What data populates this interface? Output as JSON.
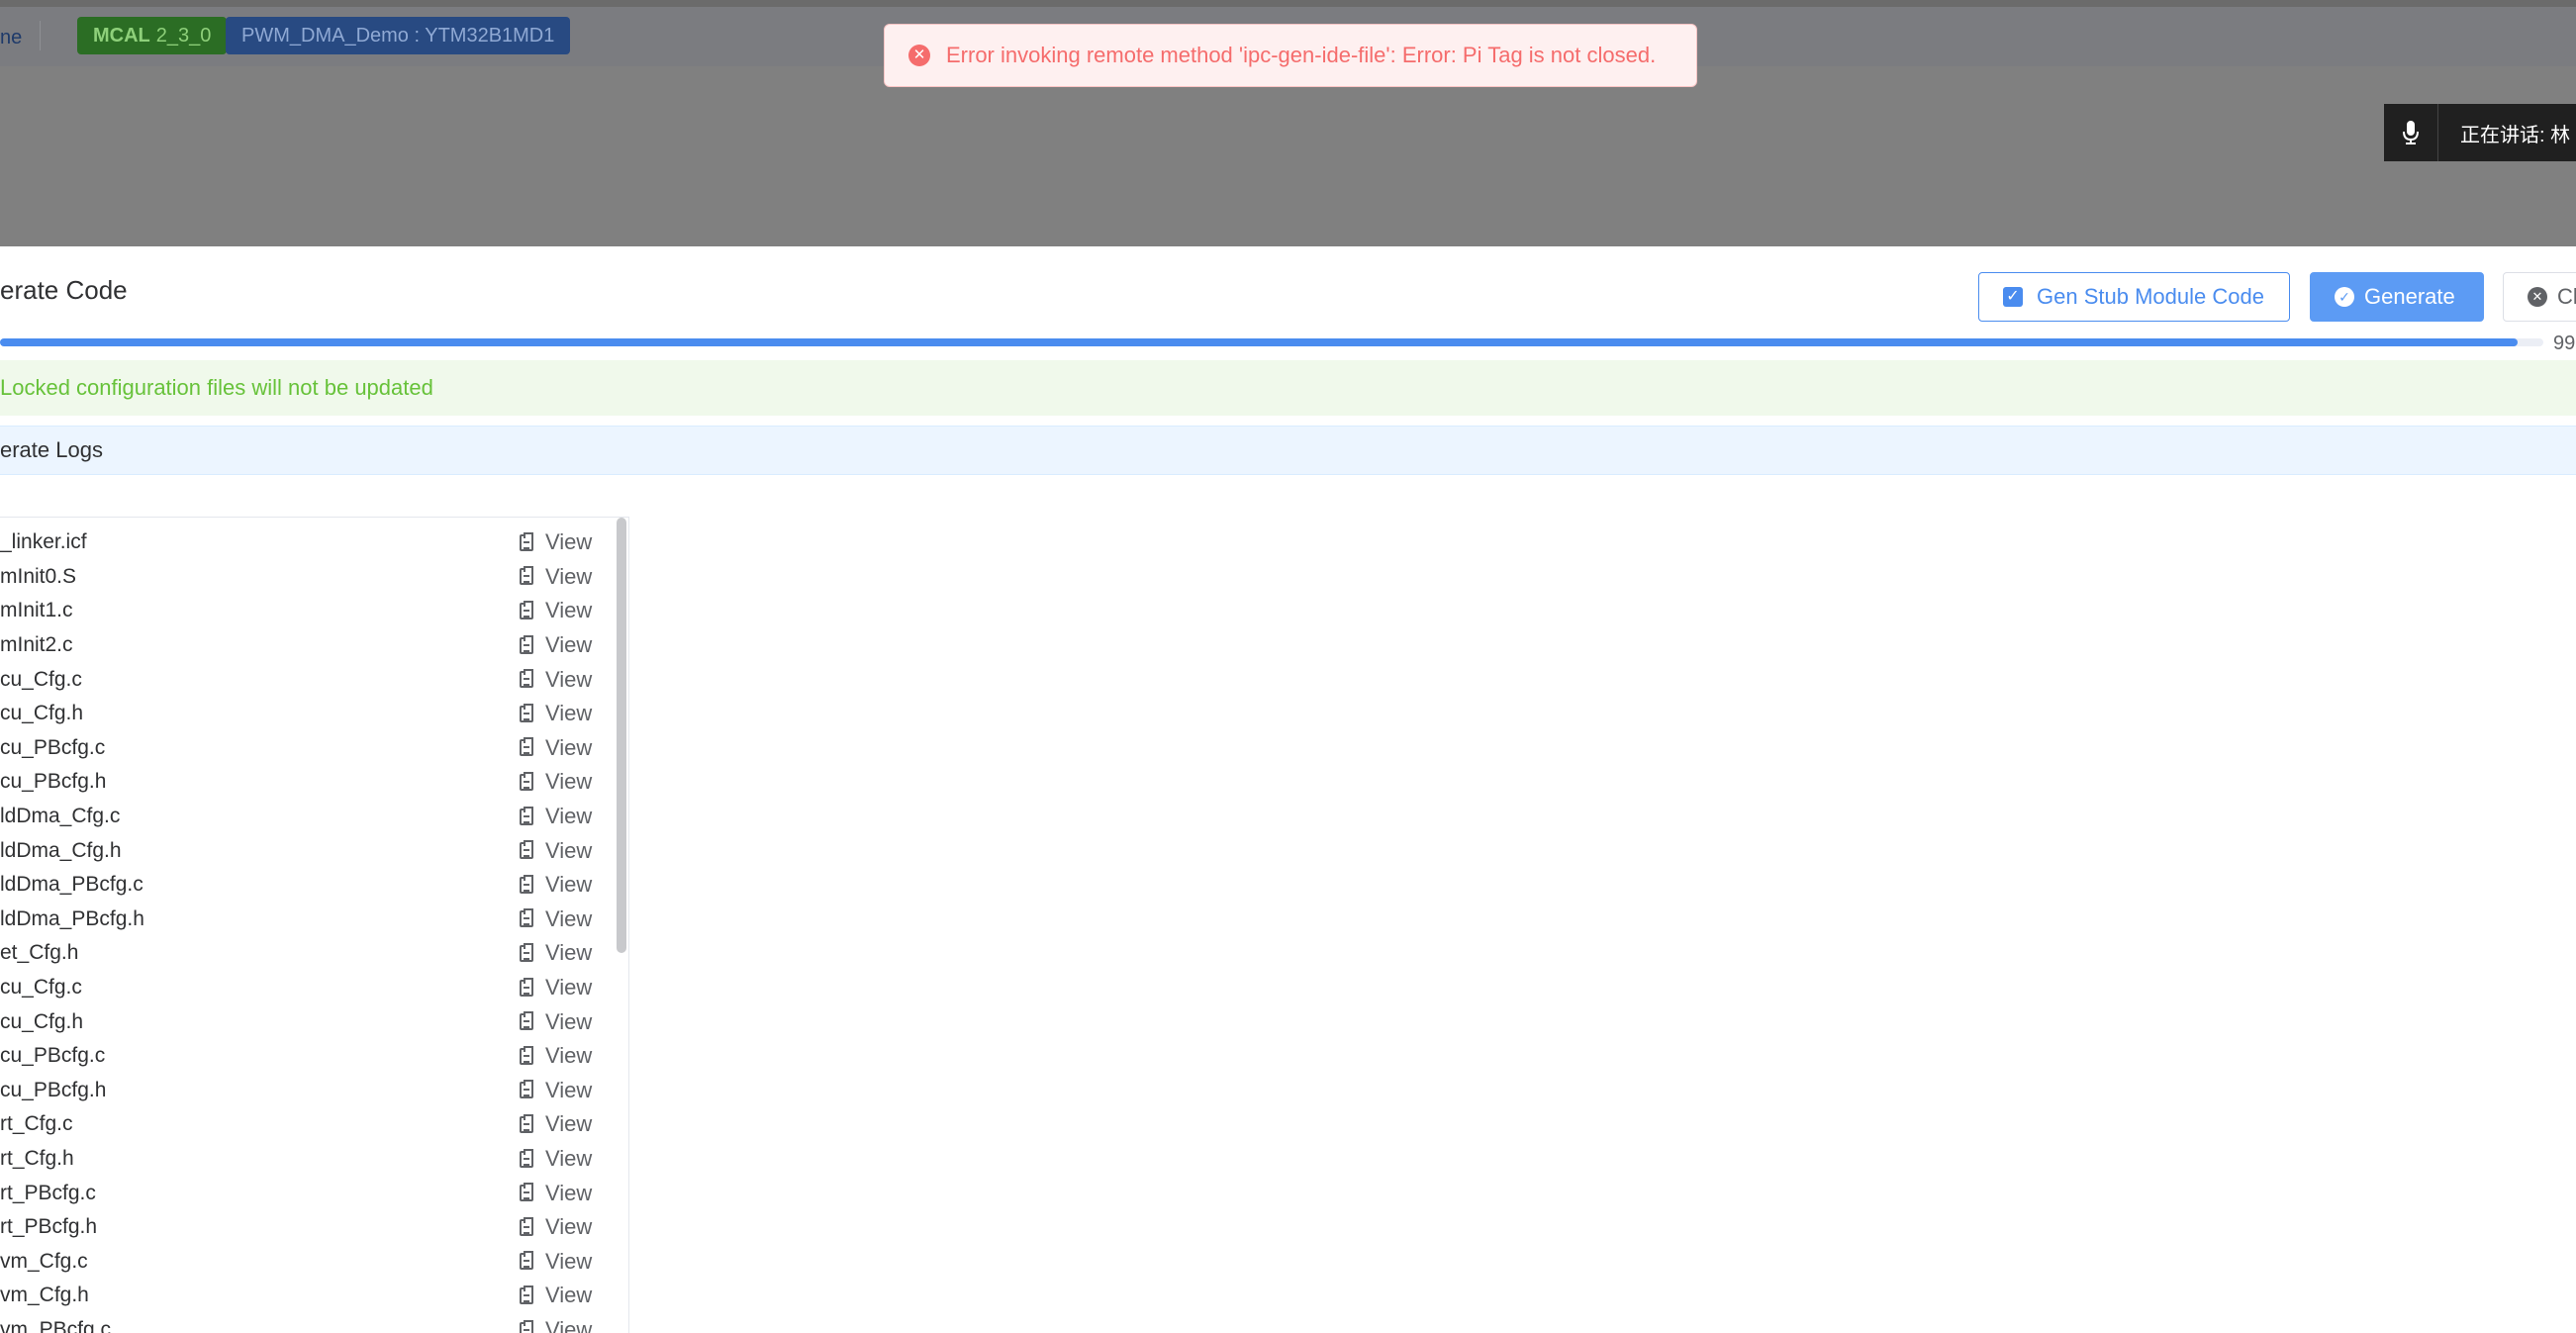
{
  "header": {
    "left_text": "ne",
    "mcal_label": "MCAL",
    "mcal_version": "2_3_0",
    "project_label": "PWM_DMA_Demo : YTM32B1MD1"
  },
  "toast": {
    "message": "Error invoking remote method 'ipc-gen-ide-file': Error: Pi Tag is not closed.",
    "icon": "error-circle-icon",
    "color": "#f56c6c"
  },
  "speaking_widget": {
    "label": "正在讲话: 林",
    "icon": "microphone-icon"
  },
  "panel": {
    "title": "erate Code",
    "buttons": {
      "stub_label": "Gen Stub Module Code",
      "stub_checked": true,
      "generate_label": "Generate",
      "close_label": "Cl"
    },
    "progress": {
      "percent": 99,
      "text": "99"
    },
    "alert_text": "Locked configuration files will not be updated",
    "logs_title": "erate Logs"
  },
  "files": {
    "view_label": "View",
    "items": [
      "_linker.icf",
      "mInit0.S",
      "mInit1.c",
      "mInit2.c",
      "cu_Cfg.c",
      "cu_Cfg.h",
      "cu_PBcfg.c",
      "cu_PBcfg.h",
      "ldDma_Cfg.c",
      "ldDma_Cfg.h",
      "ldDma_PBcfg.c",
      "ldDma_PBcfg.h",
      "et_Cfg.h",
      "cu_Cfg.c",
      "cu_Cfg.h",
      "cu_PBcfg.c",
      "cu_PBcfg.h",
      "rt_Cfg.c",
      "rt_Cfg.h",
      "rt_PBcfg.c",
      "rt_PBcfg.h",
      "vm_Cfg.c",
      "vm_Cfg.h",
      "vm_PBcfg.c"
    ]
  },
  "colors": {
    "accent": "#4a8cef",
    "success": "#67c23a",
    "error": "#f56c6c",
    "mcal_tag": "#2b6d24",
    "project_tag": "#284a82"
  }
}
